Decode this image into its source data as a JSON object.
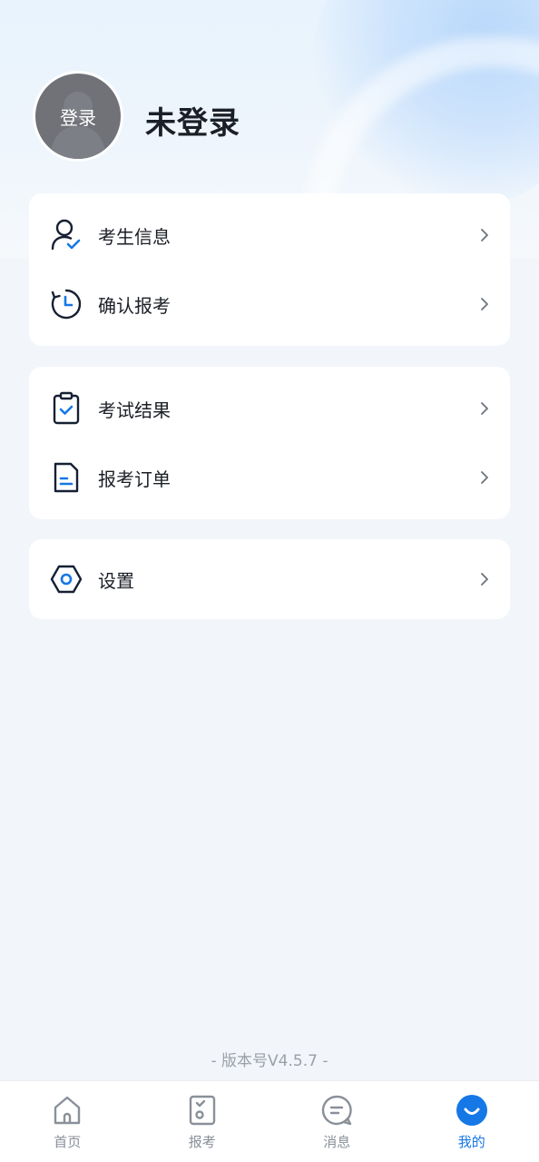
{
  "profile": {
    "avatar_label": "登录",
    "user_name": "未登录"
  },
  "groups": [
    {
      "items": [
        {
          "label": "考生信息",
          "icon": "user-check-icon"
        },
        {
          "label": "确认报考",
          "icon": "clock-refresh-icon"
        }
      ]
    },
    {
      "items": [
        {
          "label": "考试结果",
          "icon": "clipboard-check-icon"
        },
        {
          "label": "报考订单",
          "icon": "document-icon"
        }
      ]
    },
    {
      "items": [
        {
          "label": "设置",
          "icon": "settings-hexagon-icon"
        }
      ]
    }
  ],
  "version_text": "- 版本号V4.5.7 -",
  "tabbar": {
    "tabs": [
      {
        "label": "首页",
        "icon": "home-icon",
        "active": false
      },
      {
        "label": "报考",
        "icon": "exam-form-icon",
        "active": false
      },
      {
        "label": "消息",
        "icon": "message-icon",
        "active": false
      },
      {
        "label": "我的",
        "icon": "profile-face-icon",
        "active": true
      }
    ]
  },
  "colors": {
    "accent": "#1677e6",
    "icon_dark": "#162033",
    "background": "#f2f5f9"
  }
}
